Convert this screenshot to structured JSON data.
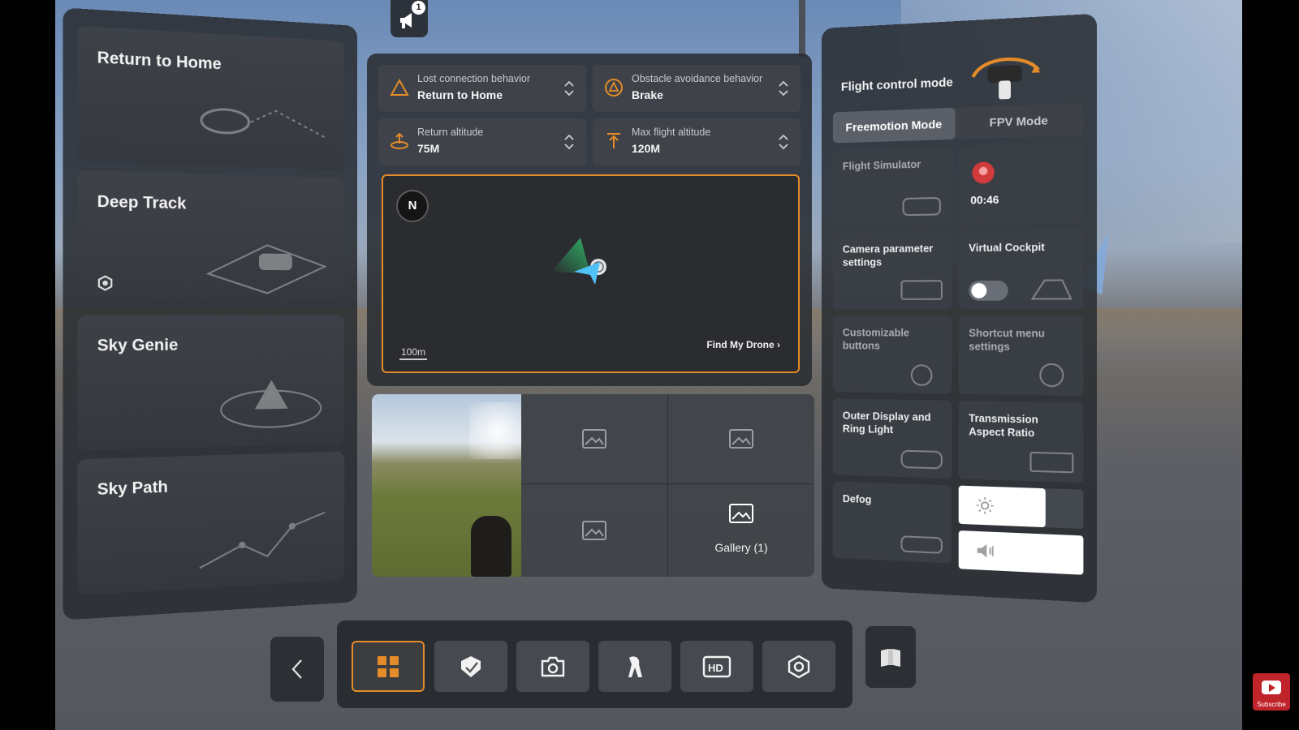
{
  "announcement": {
    "badge": "1"
  },
  "left_panel": {
    "modes": [
      {
        "label": "Return to Home"
      },
      {
        "label": "Deep Track"
      },
      {
        "label": "Sky Genie"
      },
      {
        "label": "Sky Path"
      }
    ]
  },
  "settings": {
    "lost_connection": {
      "label": "Lost connection behavior",
      "value": "Return to Home"
    },
    "obstacle_avoidance": {
      "label": "Obstacle avoidance behavior",
      "value": "Brake"
    },
    "return_altitude": {
      "label": "Return altitude",
      "value": "75M"
    },
    "max_altitude": {
      "label": "Max flight altitude",
      "value": "120M"
    }
  },
  "map": {
    "compass": "N",
    "scale": "100m",
    "find_drone": "Find My Drone ›"
  },
  "gallery": {
    "label": "Gallery (1)"
  },
  "right_panel": {
    "flight_control_mode": "Flight control mode",
    "tabs": [
      {
        "label": "Freemotion Mode",
        "active": true
      },
      {
        "label": "FPV Mode",
        "active": false
      }
    ],
    "tiles": {
      "flight_simulator": "Flight Simulator",
      "record_timer": "00:46",
      "camera_params": "Camera parameter settings",
      "virtual_cockpit": "Virtual Cockpit",
      "customizable_buttons": "Customizable buttons",
      "shortcut_menu": "Shortcut menu settings",
      "outer_display": "Outer Display and Ring Light",
      "transmission_aspect": "Transmission Aspect Ratio",
      "defog": "Defog"
    },
    "virtual_cockpit_on": false,
    "brightness_level": 0.7,
    "volume_level": 1.0
  },
  "youtube": {
    "label": "Subscribe"
  },
  "colors": {
    "accent": "#e58c2a",
    "panel": "#282b30"
  }
}
